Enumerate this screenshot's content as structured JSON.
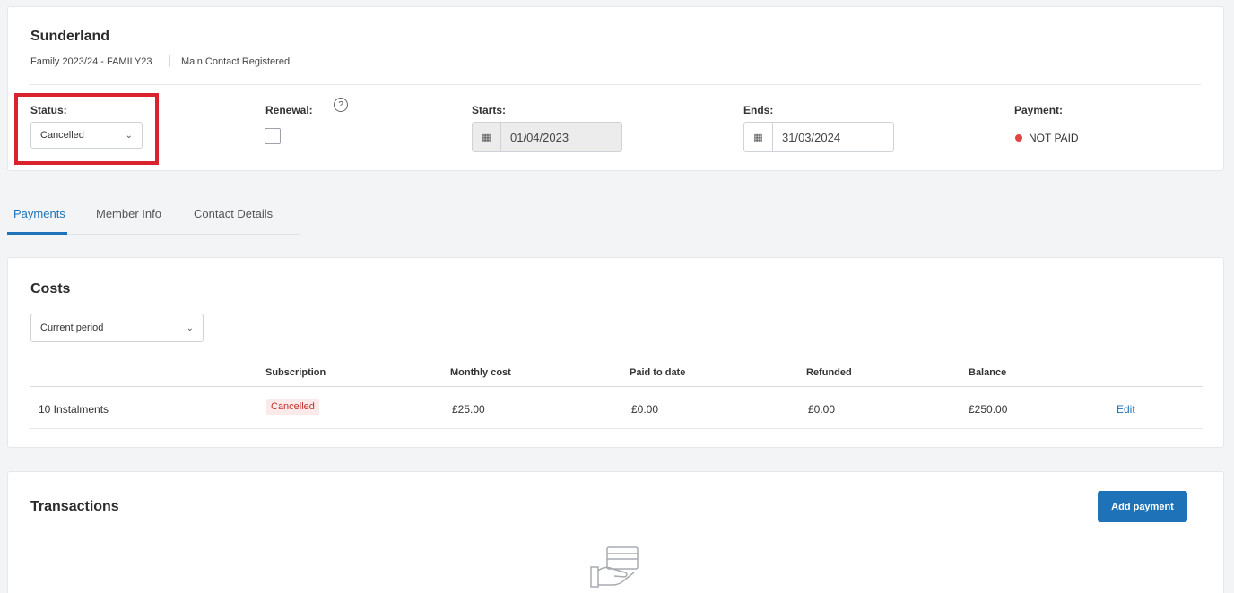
{
  "header": {
    "title": "Sunderland",
    "membership": "Family 2023/24 - FAMILY23",
    "contact_status": "Main Contact Registered"
  },
  "fields": {
    "status_label": "Status:",
    "status_value": "Cancelled",
    "renewal_label": "Renewal:",
    "starts_label": "Starts:",
    "starts_value": "01/04/2023",
    "ends_label": "Ends:",
    "ends_value": "31/03/2024",
    "payment_label": "Payment:",
    "payment_value": "NOT PAID",
    "payment_color": "#e04444"
  },
  "tabs": [
    {
      "label": "Payments",
      "active": true
    },
    {
      "label": "Member Info",
      "active": false
    },
    {
      "label": "Contact Details",
      "active": false
    }
  ],
  "costs": {
    "title": "Costs",
    "period_select": "Current period",
    "columns": [
      "",
      "Subscription",
      "Monthly cost",
      "Paid to date",
      "Refunded",
      "Balance",
      ""
    ],
    "rows": [
      {
        "plan": "10 Instalments",
        "subscription": "Cancelled",
        "monthly": "£25.00",
        "paid": "£0.00",
        "refunded": "£0.00",
        "balance": "£250.00",
        "action": "Edit"
      }
    ]
  },
  "transactions": {
    "title": "Transactions",
    "add_button": "Add payment"
  },
  "colors": {
    "accent": "#1d72b8",
    "highlight": "#d9232d"
  }
}
